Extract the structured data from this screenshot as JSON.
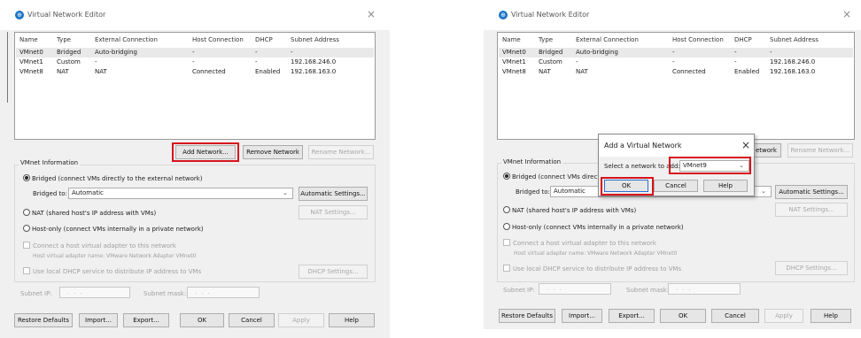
{
  "left": {
    "title": "Virtual Network Editor",
    "close_glyph": "×",
    "columns": [
      "Name",
      "Type",
      "External Connection",
      "Host Connection",
      "DHCP",
      "Subnet Address"
    ],
    "rows": [
      [
        "VMnet0",
        "Bridged",
        "Auto-bridging",
        "-",
        "-",
        "-"
      ],
      [
        "VMnet1",
        "Custom",
        "-",
        "-",
        "-",
        "192.168.246.0"
      ],
      [
        "VMnet8",
        "NAT",
        "NAT",
        "Connected",
        "Enabled",
        "192.168.163.0"
      ]
    ],
    "add_network": "Add Network...",
    "remove_network": "Remove Network",
    "rename_network": "Rename Network...",
    "vmnet_info": "VMnet Information",
    "bridged_opt": "Bridged (connect VMs directly to the external network)",
    "bridged_to_label": "Bridged to:",
    "bridged_to_value": "Automatic",
    "auto_settings": "Automatic Settings...",
    "nat_opt": "NAT (shared host's IP address with VMs)",
    "nat_settings": "NAT Settings...",
    "hostonly_opt": "Host-only (connect VMs internally in a private network)",
    "connect_adapter": "Connect a host virtual adapter to this network",
    "adapter_name": "Host virtual adapter name: VMware Network Adapter VMnet0",
    "use_dhcp": "Use local DHCP service to distribute IP address to VMs",
    "dhcp_settings": "DHCP Settings...",
    "subnet_ip": "Subnet IP:",
    "subnet_mask": "Subnet mask:",
    "ip_dots": "...",
    "restore": "Restore Defaults",
    "import": "Import...",
    "export": "Export...",
    "ok": "OK",
    "cancel": "Cancel",
    "apply": "Apply",
    "help": "Help"
  },
  "right": {
    "title": "Virtual Network Editor",
    "close_glyph": "×",
    "columns": [
      "Name",
      "Type",
      "External Connection",
      "Host Connection",
      "DHCP",
      "Subnet Address"
    ],
    "rows": [
      [
        "VMnet0",
        "Bridged",
        "Auto-bridging",
        "-",
        "-",
        "-"
      ],
      [
        "VMnet1",
        "Custom",
        "-",
        "-",
        "-",
        "192.168.246.0"
      ],
      [
        "VMnet8",
        "NAT",
        "NAT",
        "Connected",
        "Enabled",
        "192.168.163.0"
      ]
    ],
    "add_network_partial": "etwork",
    "rename_network": "Rename Network...",
    "vmnet_info": "VMnet Information",
    "bridged_opt_partial": "Bridged (connect VMs directl",
    "bridged_to_label": "Bridged to:",
    "bridged_to_value": "Automatic",
    "auto_settings": "Automatic Settings...",
    "nat_opt": "NAT (shared host's IP address with VMs)",
    "nat_settings": "NAT Settings...",
    "hostonly_opt": "Host-only (connect VMs internally in a private network)",
    "connect_adapter": "Connect a host virtual adapter to this network",
    "adapter_name": "Host virtual adapter name: VMware Network Adapter VMnet0",
    "use_dhcp": "Use local DHCP service to distribute IP address to VMs",
    "dhcp_settings": "DHCP Settings...",
    "subnet_ip": "Subnet IP:",
    "subnet_mask": "Subnet mask:",
    "ip_dots": "...",
    "restore": "Restore Defaults",
    "import": "Import...",
    "export": "Export...",
    "ok": "OK",
    "cancel": "Cancel",
    "apply": "Apply",
    "help": "Help"
  },
  "dialog": {
    "title": "Add a Virtual Network",
    "close_glyph": "×",
    "select_label": "Select a network to add:",
    "selected": "VMnet9",
    "ok": "OK",
    "cancel": "Cancel",
    "help": "Help"
  },
  "icons": {
    "app": "vmware-network-icon",
    "chevron": "chevron-down-icon",
    "close": "close-icon"
  },
  "colors": {
    "highlight": "#d8121c",
    "accent": "#1a73c8"
  }
}
